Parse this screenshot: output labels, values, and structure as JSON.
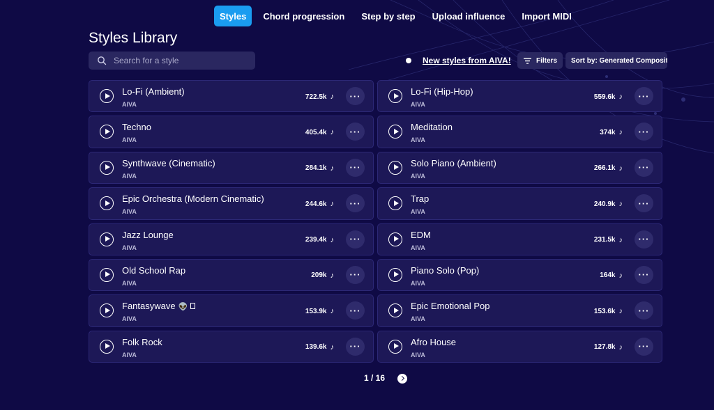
{
  "nav": {
    "tabs": [
      {
        "label": "Styles",
        "active": true
      },
      {
        "label": "Chord progression",
        "active": false
      },
      {
        "label": "Step by step",
        "active": false
      },
      {
        "label": "Upload influence",
        "active": false
      },
      {
        "label": "Import MIDI",
        "active": false
      }
    ]
  },
  "library": {
    "title": "Styles Library",
    "search_placeholder": "Search for a style",
    "new_styles_link": "New styles from AIVA!",
    "filters_label": "Filters",
    "sort_label": "Sort by: Generated Compositions"
  },
  "styles": [
    {
      "name": "Lo-Fi (Ambient)",
      "author": "AIVA",
      "plays": "722.5k"
    },
    {
      "name": "Lo-Fi (Hip-Hop)",
      "author": "AIVA",
      "plays": "559.6k"
    },
    {
      "name": "Techno",
      "author": "AIVA",
      "plays": "405.4k"
    },
    {
      "name": "Meditation",
      "author": "AIVA",
      "plays": "374k"
    },
    {
      "name": "Synthwave (Cinematic)",
      "author": "AIVA",
      "plays": "284.1k"
    },
    {
      "name": "Solo Piano (Ambient)",
      "author": "AIVA",
      "plays": "266.1k"
    },
    {
      "name": "Epic Orchestra (Modern Cinematic)",
      "author": "AIVA",
      "plays": "244.6k"
    },
    {
      "name": "Trap",
      "author": "AIVA",
      "plays": "240.9k"
    },
    {
      "name": "Jazz Lounge",
      "author": "AIVA",
      "plays": "239.4k"
    },
    {
      "name": "EDM",
      "author": "AIVA",
      "plays": "231.5k"
    },
    {
      "name": "Old School Rap",
      "author": "AIVA",
      "plays": "209k"
    },
    {
      "name": "Piano Solo (Pop)",
      "author": "AIVA",
      "plays": "164k"
    },
    {
      "name": "Fantasywave",
      "author": "AIVA",
      "plays": "153.9k",
      "emoji": "👽"
    },
    {
      "name": "Epic Emotional Pop",
      "author": "AIVA",
      "plays": "153.6k"
    },
    {
      "name": "Folk Rock",
      "author": "AIVA",
      "plays": "139.6k"
    },
    {
      "name": "Afro House",
      "author": "AIVA",
      "plays": "127.8k"
    }
  ],
  "pagination": {
    "current": "1 / 16"
  },
  "colors": {
    "accent": "#1a9cf0",
    "background": "#0f0a45",
    "card": "#1d1857"
  },
  "icons": {
    "play": "play-icon",
    "more": "more-icon",
    "note": "music-note-icon"
  }
}
